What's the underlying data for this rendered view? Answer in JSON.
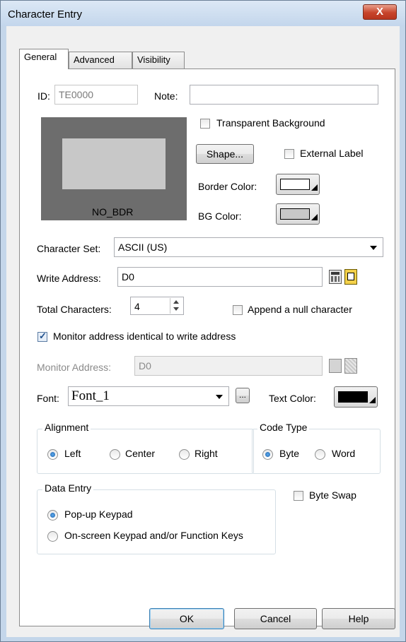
{
  "window": {
    "title": "Character Entry",
    "close_label": "X"
  },
  "tabs": [
    {
      "label": "General"
    },
    {
      "label": "Advanced"
    },
    {
      "label": "Visibility"
    }
  ],
  "general": {
    "id_label": "ID:",
    "id_value": "TE0000",
    "note_label": "Note:",
    "note_value": "",
    "preview_caption": "NO_BDR",
    "transparent_bg_label": "Transparent Background",
    "transparent_bg_checked": false,
    "shape_button": "Shape...",
    "external_label_label": "External Label",
    "external_label_checked": false,
    "border_color_label": "Border Color:",
    "border_color": "#ffffff",
    "bg_color_label": "BG Color:",
    "bg_color": "#c8c8c8",
    "charset_label": "Character Set:",
    "charset_value": "ASCII (US)",
    "write_address_label": "Write Address:",
    "write_address_value": "D0",
    "total_chars_label": "Total Characters:",
    "total_chars_value": "4",
    "append_null_label": "Append a null character",
    "append_null_checked": false,
    "monitor_identical_label": "Monitor address identical to write address",
    "monitor_identical_checked": true,
    "monitor_address_label": "Monitor Address:",
    "monitor_address_value": "D0",
    "font_label": "Font:",
    "font_value": "Font_1",
    "font_more_button": "...",
    "text_color_label": "Text Color:",
    "text_color": "#000000",
    "alignment": {
      "title": "Alignment",
      "options": [
        "Left",
        "Center",
        "Right"
      ],
      "selected": "Left"
    },
    "code_type": {
      "title": "Code Type",
      "options": [
        "Byte",
        "Word"
      ],
      "selected": "Byte"
    },
    "data_entry": {
      "title": "Data Entry",
      "options": [
        "Pop-up Keypad",
        "On-screen Keypad and/or Function Keys"
      ],
      "selected": "Pop-up Keypad"
    },
    "byte_swap_label": "Byte Swap",
    "byte_swap_checked": false
  },
  "footer": {
    "ok": "OK",
    "cancel": "Cancel",
    "help": "Help"
  },
  "colors": {
    "window_frame": "#c4d6ea",
    "close_button": "#c7442b",
    "dialog_bg": "#f0f0f0",
    "preview_border": "#6d6d6d",
    "preview_fill": "#c8c8c8"
  }
}
